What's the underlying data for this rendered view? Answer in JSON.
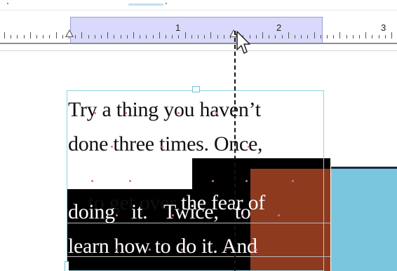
{
  "ruler": {
    "numbers": [
      "1",
      "2",
      "3"
    ]
  },
  "document": {
    "lines": [
      "Try a thing you haven’t",
      "done three times. Once,",
      "to get over the fear of",
      "doing it. Twice, to",
      "learn how to do it. And"
    ]
  },
  "colors": {
    "ruler_selection": "#d9d9fb",
    "text_highlight": "#000000",
    "column_highlight": "#8e3a1f",
    "side_panel": "#79c6df",
    "frame_border": "#8fd3de",
    "space_marker": "#d86aa8"
  },
  "icons": {
    "cursor": "arrow-pointer-icon",
    "margin_markers": "triangle-indent-icon",
    "frame_handle": "square-handle-icon"
  }
}
